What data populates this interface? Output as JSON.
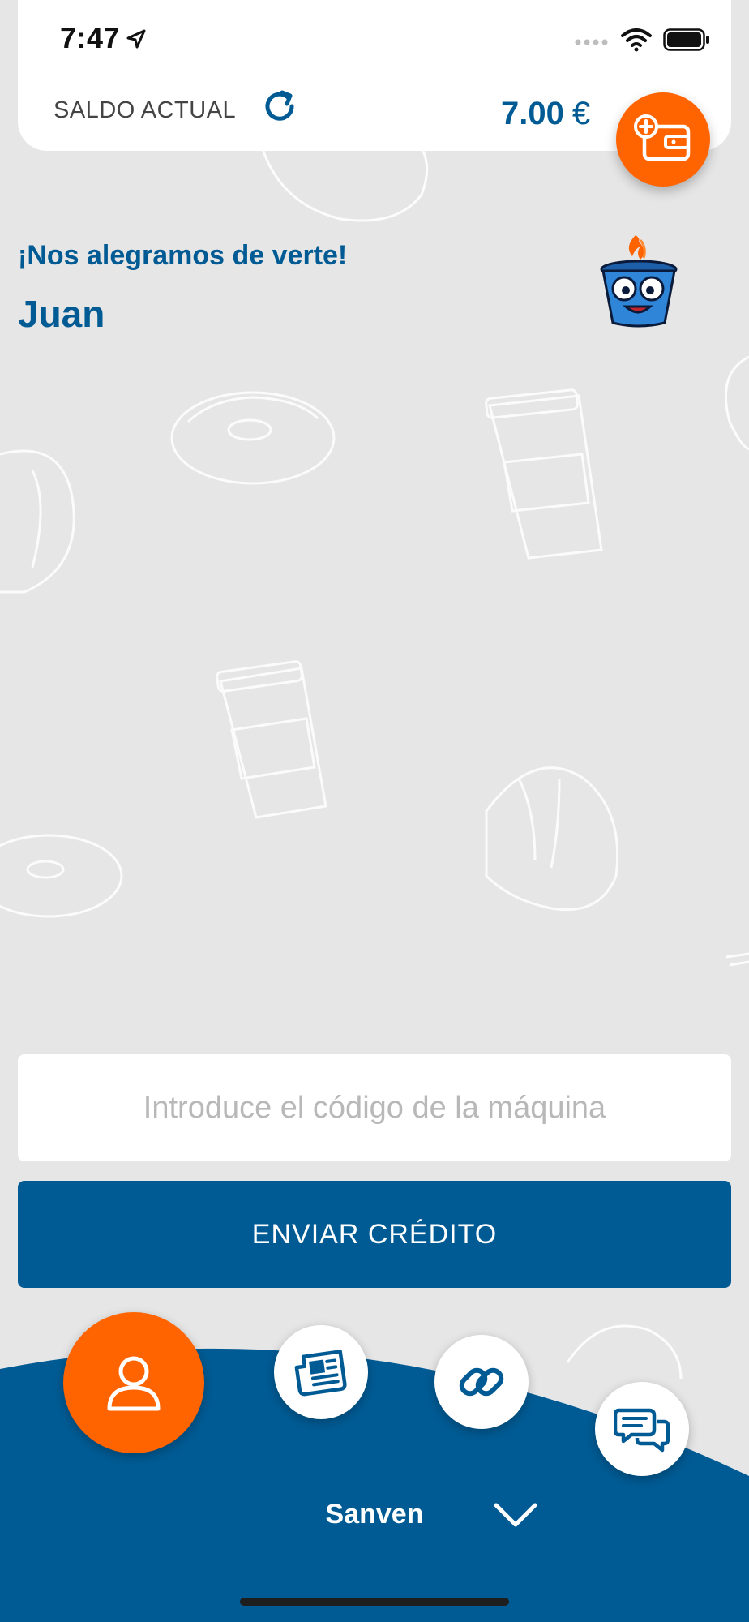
{
  "status_bar": {
    "time": "7:47"
  },
  "header": {
    "balance_label": "SALDO ACTUAL",
    "balance_amount": "7.00",
    "currency": "€"
  },
  "welcome": {
    "greeting": "¡Nos alegramos de verte!",
    "user_name": "Juan"
  },
  "machine_code": {
    "placeholder": "Introduce el código de la máquina",
    "value": ""
  },
  "send_button": {
    "label": "ENVIAR CRÉDITO"
  },
  "bottom_nav": {
    "items": [
      {
        "icon": "user-icon",
        "active": true
      },
      {
        "icon": "newspaper-icon",
        "active": false
      },
      {
        "icon": "link-icon",
        "active": false
      },
      {
        "icon": "chat-icon",
        "active": false
      }
    ],
    "brand_label": "Sanven",
    "chevron_icon": "chevron-down-icon"
  },
  "colors": {
    "primary_blue": "#005b94",
    "accent_orange": "#ff6400",
    "background": "#e6e6e6"
  }
}
